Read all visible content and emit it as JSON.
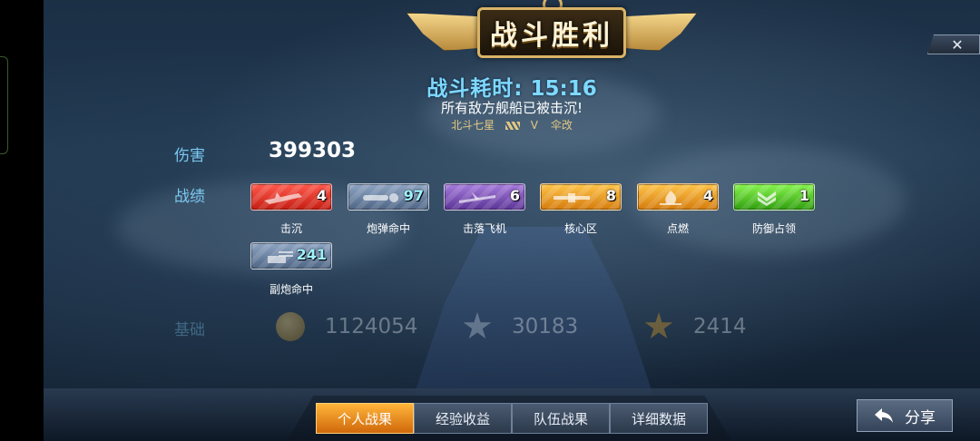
{
  "header": {
    "title": "战斗胜利",
    "close_glyph": "✕"
  },
  "battle": {
    "duration_label": "战斗耗时:",
    "duration_value": "15:16",
    "result_text": "所有敌方舰船已被击沉!",
    "ship_name": "北斗七星",
    "ship_tier": "V",
    "ship_class": "伞改"
  },
  "damage": {
    "label": "伤害",
    "value": "399303"
  },
  "achievements": {
    "label": "战绩",
    "items": [
      {
        "name": "击沉",
        "count": "4",
        "color": "red",
        "icon": "sinking-ship-icon"
      },
      {
        "name": "炮弹命中",
        "count": "97",
        "color": "steel",
        "icon": "shell-icon"
      },
      {
        "name": "击落飞机",
        "count": "6",
        "color": "purple",
        "icon": "plane-icon"
      },
      {
        "name": "核心区",
        "count": "8",
        "color": "orange",
        "icon": "torpedo-icon"
      },
      {
        "name": "点燃",
        "count": "4",
        "color": "orange",
        "icon": "fire-icon"
      },
      {
        "name": "防御占领",
        "count": "1",
        "color": "green",
        "icon": "chevron-icon"
      },
      {
        "name": "副炮命中",
        "count": "241",
        "color": "steel",
        "icon": "secondary-gun-icon"
      }
    ]
  },
  "base": {
    "label": "基础",
    "silver": "1124054",
    "exp": "30183",
    "rank": "2414"
  },
  "tabs": [
    {
      "label": "个人战果",
      "active": true
    },
    {
      "label": "经验收益",
      "active": false
    },
    {
      "label": "队伍战果",
      "active": false
    },
    {
      "label": "详细数据",
      "active": false
    }
  ],
  "share": {
    "label": "分享"
  }
}
